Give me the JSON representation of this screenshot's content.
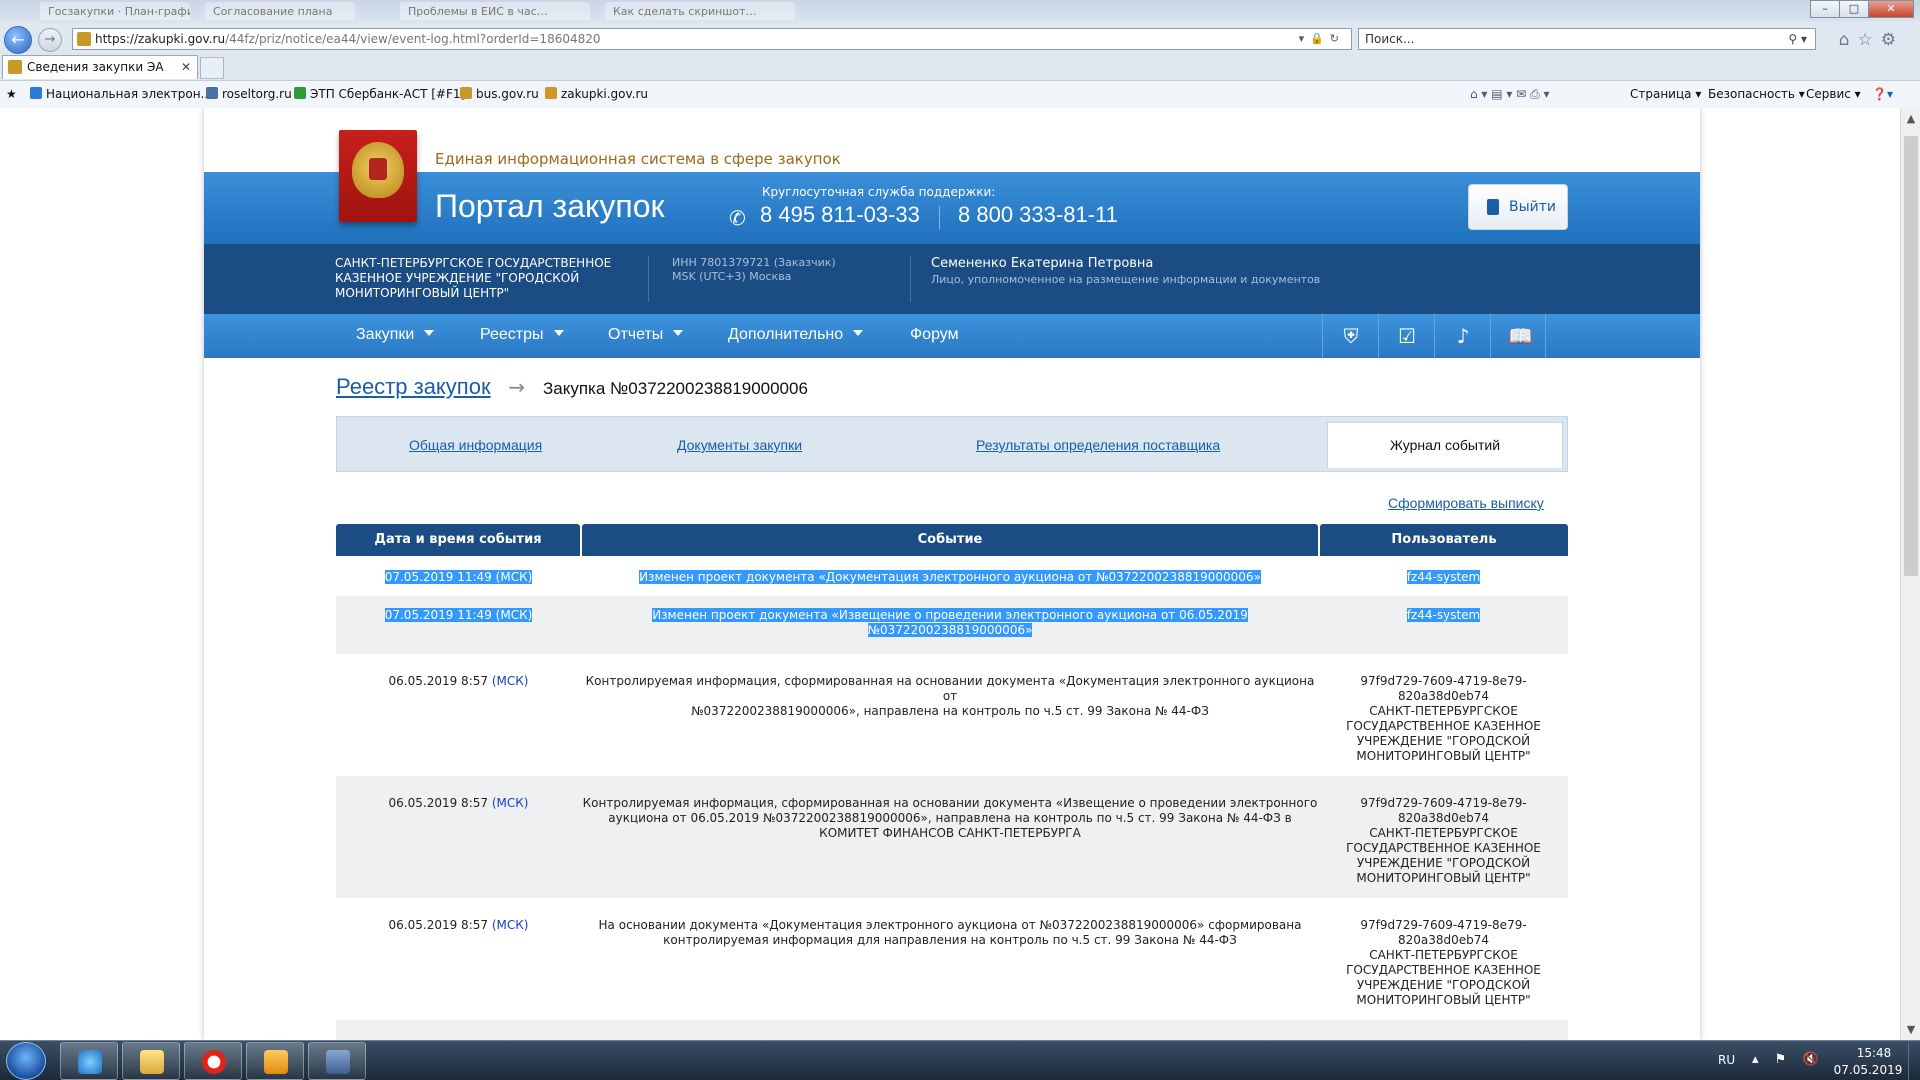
{
  "browser": {
    "ghost_tabs": [
      "Госзакупки · План-график",
      "Согласование плана",
      "Проблемы в ЕИС в час…",
      "Как сделать скриншот…"
    ],
    "url_main": "https://zakupki.gov.ru",
    "url_rest": "/44fz/priz/notice/ea44/view/event-log.html?orderId=18604820",
    "search_placeholder": "Поиск...",
    "active_tab_title": "Сведения закупки ЭА",
    "favorites": [
      {
        "label": "Национальная электрон...",
        "color": "#2f79d6"
      },
      {
        "label": "roseltorg.ru",
        "color": "#4a6fa3"
      },
      {
        "label": "ЭТП Сбербанк-АСТ [#F1]",
        "color": "#2e9b3a"
      },
      {
        "label": "bus.gov.ru",
        "color": "#c99828"
      },
      {
        "label": "zakupki.gov.ru",
        "color": "#c99828"
      }
    ],
    "commands": [
      "Страница ▾",
      "Безопасность ▾",
      "Сервис ▾"
    ]
  },
  "header": {
    "eis_title": "Единая информационная система в сфере закупок",
    "portal_title": "Портал закупок",
    "support_label": "Круглосуточная служба поддержки:",
    "phone1": "8 495 811-03-33",
    "phone2": "8 800 333-81-11",
    "logout_label": "Выйти"
  },
  "org": {
    "name": "САНКТ-ПЕТЕРБУРГСКОЕ ГОСУДАРСТВЕННОЕ КАЗЕННОЕ УЧРЕЖДЕНИЕ \"ГОРОДСКОЙ МОНИТОРИНГОВЫЙ ЦЕНТР\"",
    "inn": "ИНН 7801379721 (Заказчик)",
    "tz": "MSK (UTC+3) Москва",
    "user_name": "Семененко Екатерина Петровна",
    "user_role": "Лицо, уполномоченное на размещение информации и документов"
  },
  "nav": {
    "items": [
      "Закупки",
      "Реестры",
      "Отчеты",
      "Дополнительно",
      "Форум"
    ],
    "icons": [
      "shield-icon",
      "calendar-check-icon",
      "bell-icon",
      "book-search-icon"
    ]
  },
  "breadcrumb": {
    "parent": "Реестр закупок",
    "current": "Закупка №0372200238819000006"
  },
  "tabs": {
    "general": "Общая информация",
    "documents": "Документы закупки",
    "results": "Результаты определения поставщика",
    "journal": "Журнал событий"
  },
  "export_link": "Сформировать выписку",
  "table": {
    "headers": [
      "Дата и время события",
      "Событие",
      "Пользователь"
    ],
    "msk": "(МСК)",
    "rows": [
      {
        "date": "07.05.2019 11:49",
        "event": "Изменен проект документа «Документация электронного аукциона от №0372200238819000006»",
        "user": "fz44-system"
      },
      {
        "date": "07.05.2019 11:49",
        "event_line1": "Изменен проект документа «Извещение о проведении электронного аукциона от 06.05.2019",
        "event_line2": "№0372200238819000006»",
        "user": "fz44-system"
      },
      {
        "date": "06.05.2019 8:57",
        "event_line1": "Контролируемая информация, сформированная на основании документа «Документация электронного аукциона от",
        "event_line2": "№0372200238819000006», направлена на контроль по ч.5 ст. 99 Закона № 44-ФЗ",
        "user_id1": "97f9d729-7609-4719-8e79-",
        "user_id2": "820a38d0eb74",
        "user_org1": "САНКТ-ПЕТЕРБУРГСКОЕ",
        "user_org2": "ГОСУДАРСТВЕННОЕ КАЗЕННОЕ",
        "user_org3": "УЧРЕЖДЕНИЕ \"ГОРОДСКОЙ",
        "user_org4": "МОНИТОРИНГОВЫЙ ЦЕНТР\""
      },
      {
        "date": "06.05.2019 8:57",
        "event_line1": "Контролируемая информация, сформированная на основании документа «Извещение о проведении электронного",
        "event_line2": "аукциона от 06.05.2019 №0372200238819000006», направлена на контроль по ч.5 ст. 99 Закона № 44-ФЗ в",
        "event_line3": "КОМИТЕТ ФИНАНСОВ САНКТ-ПЕТЕРБУРГА",
        "user_id1": "97f9d729-7609-4719-8e79-",
        "user_id2": "820a38d0eb74",
        "user_org1": "САНКТ-ПЕТЕРБУРГСКОЕ",
        "user_org2": "ГОСУДАРСТВЕННОЕ КАЗЕННОЕ",
        "user_org3": "УЧРЕЖДЕНИЕ \"ГОРОДСКОЙ",
        "user_org4": "МОНИТОРИНГОВЫЙ ЦЕНТР\""
      },
      {
        "date": "06.05.2019 8:57",
        "event_line1": "На основании документа «Документация электронного аукциона от №0372200238819000006» сформирована",
        "event_line2": "контролируемая информация для направления на контроль по ч.5 ст. 99 Закона № 44-ФЗ",
        "user_id1": "97f9d729-7609-4719-8e79-",
        "user_id2": "820a38d0eb74",
        "user_org1": "САНКТ-ПЕТЕРБУРГСКОЕ",
        "user_org2": "ГОСУДАРСТВЕННОЕ КАЗЕННОЕ",
        "user_org3": "УЧРЕЖДЕНИЕ \"ГОРОДСКОЙ",
        "user_org4": "МОНИТОРИНГОВЫЙ ЦЕНТР\""
      }
    ]
  },
  "taskbar": {
    "lang": "RU",
    "time": "15:48",
    "date": "07.05.2019",
    "apps": [
      "internet-explorer-icon",
      "file-explorer-icon",
      "yandex-browser-icon",
      "outlook-icon",
      "app-icon"
    ]
  },
  "colors": {
    "header_blue": "#2a78c4",
    "org_band": "#1b4c84",
    "link": "#1a5ea7",
    "selection": "#3399ff"
  }
}
